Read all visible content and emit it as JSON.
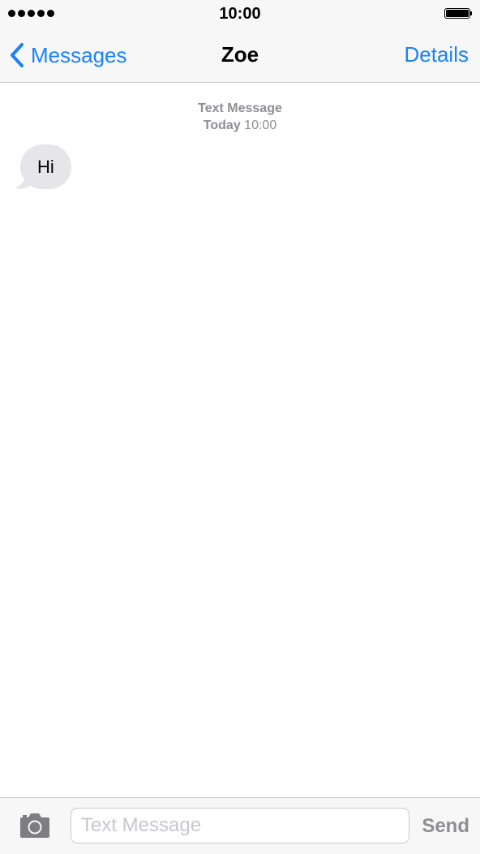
{
  "status_bar": {
    "time": "10:00",
    "signal_icon": "signal-dots-icon",
    "battery_icon": "battery-full-icon"
  },
  "nav": {
    "back_label": "Messages",
    "back_icon": "chevron-left-icon",
    "title": "Zoe",
    "details_label": "Details"
  },
  "conversation": {
    "timestamp": {
      "type": "Text Message",
      "day": "Today",
      "time": "10:00"
    },
    "messages": [
      {
        "direction": "incoming",
        "text": "Hi"
      }
    ]
  },
  "composer": {
    "camera_icon": "camera-icon",
    "placeholder": "Text Message",
    "value": "",
    "send_label": "Send"
  },
  "colors": {
    "accent": "#1a82f7",
    "bar_background": "#f7f7f7",
    "incoming_bubble": "#e5e5ea",
    "secondary_text": "#8e8e93"
  }
}
